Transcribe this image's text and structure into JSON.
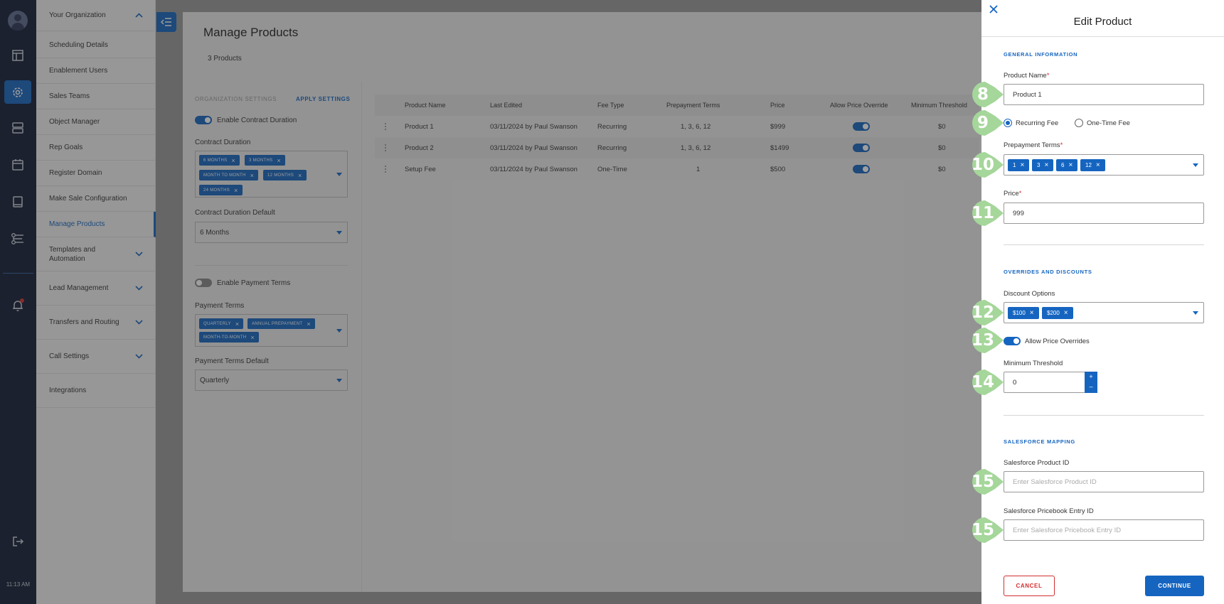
{
  "rail": {
    "time": "11:13 AM",
    "icons": [
      "avatar",
      "dashboard-icon",
      "settings-icon",
      "server-icon",
      "calendar-icon",
      "book-icon",
      "routing-icon",
      "bell-icon",
      "logout-icon"
    ]
  },
  "sidebar": {
    "items": [
      {
        "label": "Your Organization"
      },
      {
        "label": "Scheduling Details"
      },
      {
        "label": "Enablement Users"
      },
      {
        "label": "Sales Teams"
      },
      {
        "label": "Object Manager"
      },
      {
        "label": "Rep Goals"
      },
      {
        "label": "Register Domain"
      },
      {
        "label": "Make Sale Configuration"
      },
      {
        "label": "Manage Products"
      },
      {
        "label": "Templates and Automation"
      },
      {
        "label": "Lead Management"
      },
      {
        "label": "Transfers and Routing"
      },
      {
        "label": "Call Settings"
      },
      {
        "label": "Integrations"
      }
    ]
  },
  "main": {
    "title": "Manage Products",
    "count": "3 Products",
    "settings": {
      "header": "ORGANIZATION SETTINGS",
      "apply": "APPLY SETTINGS",
      "enable_contract_duration": "Enable Contract Duration",
      "contract_duration_label": "Contract Duration",
      "contract_chips": [
        "6 MONTHS",
        "3 MONTHS",
        "MONTH TO MONTH",
        "12 MONTHS",
        "24 MONTHS"
      ],
      "contract_default_label": "Contract Duration Default",
      "contract_default_value": "6 Months",
      "enable_payment_terms": "Enable Payment Terms",
      "payment_terms_label": "Payment Terms",
      "payment_chips": [
        "QUARTERLY",
        "ANNUAL PREPAYMENT",
        "MONTH-TO-MONTH"
      ],
      "payment_default_label": "Payment Terms Default",
      "payment_default_value": "Quarterly"
    },
    "table": {
      "headers": [
        "Product Name",
        "Last Edited",
        "Fee Type",
        "Prepayment Terms",
        "Price",
        "Allow Price Override",
        "Minimum Threshold"
      ],
      "rows": [
        {
          "name": "Product 1",
          "edited": "03/11/2024 by Paul Swanson",
          "fee": "Recurring",
          "terms": "1, 3, 6, 12",
          "price": "$999",
          "override": true,
          "min": "$0"
        },
        {
          "name": "Product 2",
          "edited": "03/11/2024 by Paul Swanson",
          "fee": "Recurring",
          "terms": "1, 3, 6, 12",
          "price": "$1499",
          "override": true,
          "min": "$0"
        },
        {
          "name": "Setup Fee",
          "edited": "03/11/2024 by Paul Swanson",
          "fee": "One-Time",
          "terms": "1",
          "price": "$500",
          "override": true,
          "min": "$0"
        }
      ]
    }
  },
  "drawer": {
    "title": "Edit Product",
    "general_header": "GENERAL INFORMATION",
    "product_name_label": "Product Name",
    "product_name_value": "Product 1",
    "fee_recurring": "Recurring Fee",
    "fee_one_time": "One-Time Fee",
    "fee_selected": "Recurring Fee",
    "prepayment_label": "Prepayment Terms",
    "prepayment_chips": [
      "1",
      "3",
      "6",
      "12"
    ],
    "price_label": "Price",
    "price_value": "999",
    "overrides_header": "OVERRIDES AND DISCOUNTS",
    "discount_label": "Discount Options",
    "discount_chips": [
      "$100",
      "$200"
    ],
    "allow_overrides_label": "Allow Price Overrides",
    "min_threshold_label": "Minimum Threshold",
    "min_threshold_value": "0",
    "stepper_plus": "+",
    "stepper_minus": "–",
    "sf_header": "SALESFORCE MAPPING",
    "sf_product_label": "Salesforce Product ID",
    "sf_product_placeholder": "Enter Salesforce Product ID",
    "sf_pricebook_label": "Salesforce Pricebook Entry ID",
    "sf_pricebook_placeholder": "Enter Salesforce Pricebook Entry ID",
    "cancel": "CANCEL",
    "continue": "CONTINUE",
    "required_mark": "*"
  },
  "callouts": [
    "8",
    "9",
    "10",
    "11",
    "12",
    "13",
    "14",
    "15",
    "15"
  ],
  "colors": {
    "accent": "#1565c0",
    "rail": "#121d33",
    "required": "#d32f2f",
    "callout": "#a5d69a"
  }
}
